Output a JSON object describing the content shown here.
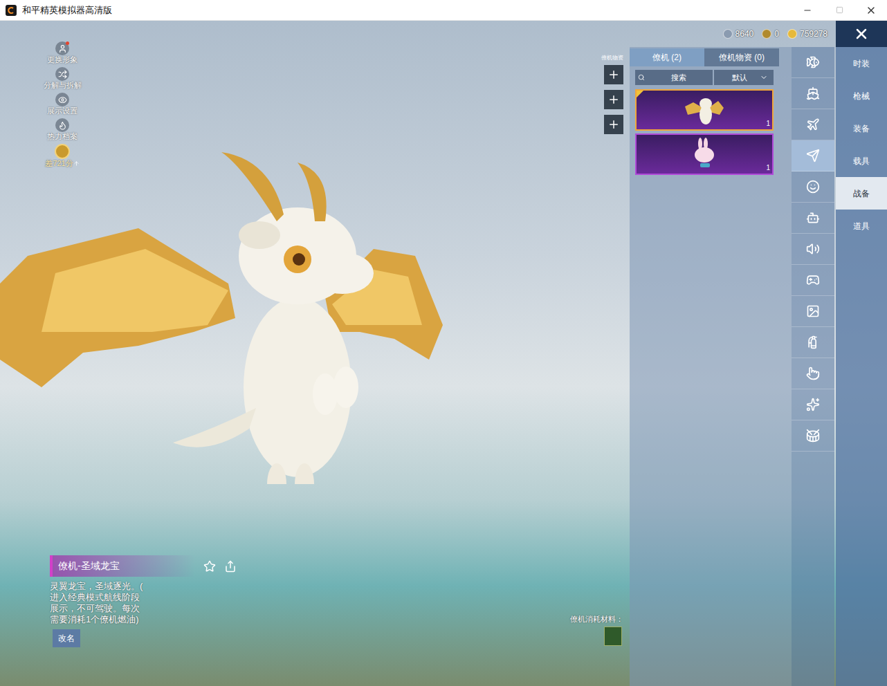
{
  "window": {
    "title": "和平精英模拟器高清版"
  },
  "currencies": [
    {
      "value": "8640",
      "color": "#8a9bb0"
    },
    {
      "value": "0",
      "color": "#b08a2e"
    },
    {
      "value": "759278",
      "color": "#e6b93a"
    }
  ],
  "left_menu": [
    {
      "label": "更换形象",
      "dot": true
    },
    {
      "label": "分解与拆解",
      "dot": false
    },
    {
      "label": "展示设置",
      "dot": false
    },
    {
      "label": "热力档案",
      "dot": false
    }
  ],
  "score": {
    "label": "差721分"
  },
  "plus_panel": {
    "label": "僚机物资",
    "buttons": 3
  },
  "panel": {
    "tabs": [
      {
        "label": "僚机 (2)",
        "selected": true
      },
      {
        "label": "僚机物资 (0)",
        "selected": false
      }
    ],
    "search": {
      "placeholder": "搜索"
    },
    "sort": {
      "value": "默认"
    },
    "cards": [
      {
        "kind": "dragon",
        "count": "1",
        "selected": true
      },
      {
        "kind": "rabbit",
        "count": "1",
        "selected": false
      }
    ]
  },
  "icon_tabs": [
    {
      "selected": false
    },
    {
      "selected": false
    },
    {
      "selected": false
    },
    {
      "selected": true
    },
    {
      "selected": false
    },
    {
      "selected": false
    },
    {
      "selected": false
    },
    {
      "selected": false
    },
    {
      "selected": false
    },
    {
      "selected": false
    },
    {
      "selected": false
    },
    {
      "selected": false
    },
    {
      "selected": false
    }
  ],
  "categories": [
    {
      "label": "时装",
      "selected": false
    },
    {
      "label": "枪械",
      "selected": false
    },
    {
      "label": "装备",
      "selected": false
    },
    {
      "label": "载具",
      "selected": false
    },
    {
      "label": "战备",
      "selected": true
    },
    {
      "label": "道具",
      "selected": false
    }
  ],
  "info": {
    "title": "僚机-圣域龙宝",
    "description_lines": [
      "灵翼龙宝，圣域逐光。(",
      "进入经典模式航线阶段",
      "展示，不可驾驶。每次",
      "需要消耗1个僚机燃油)"
    ],
    "rename_button": "改名"
  },
  "material": {
    "label": "僚机消耗材料："
  }
}
